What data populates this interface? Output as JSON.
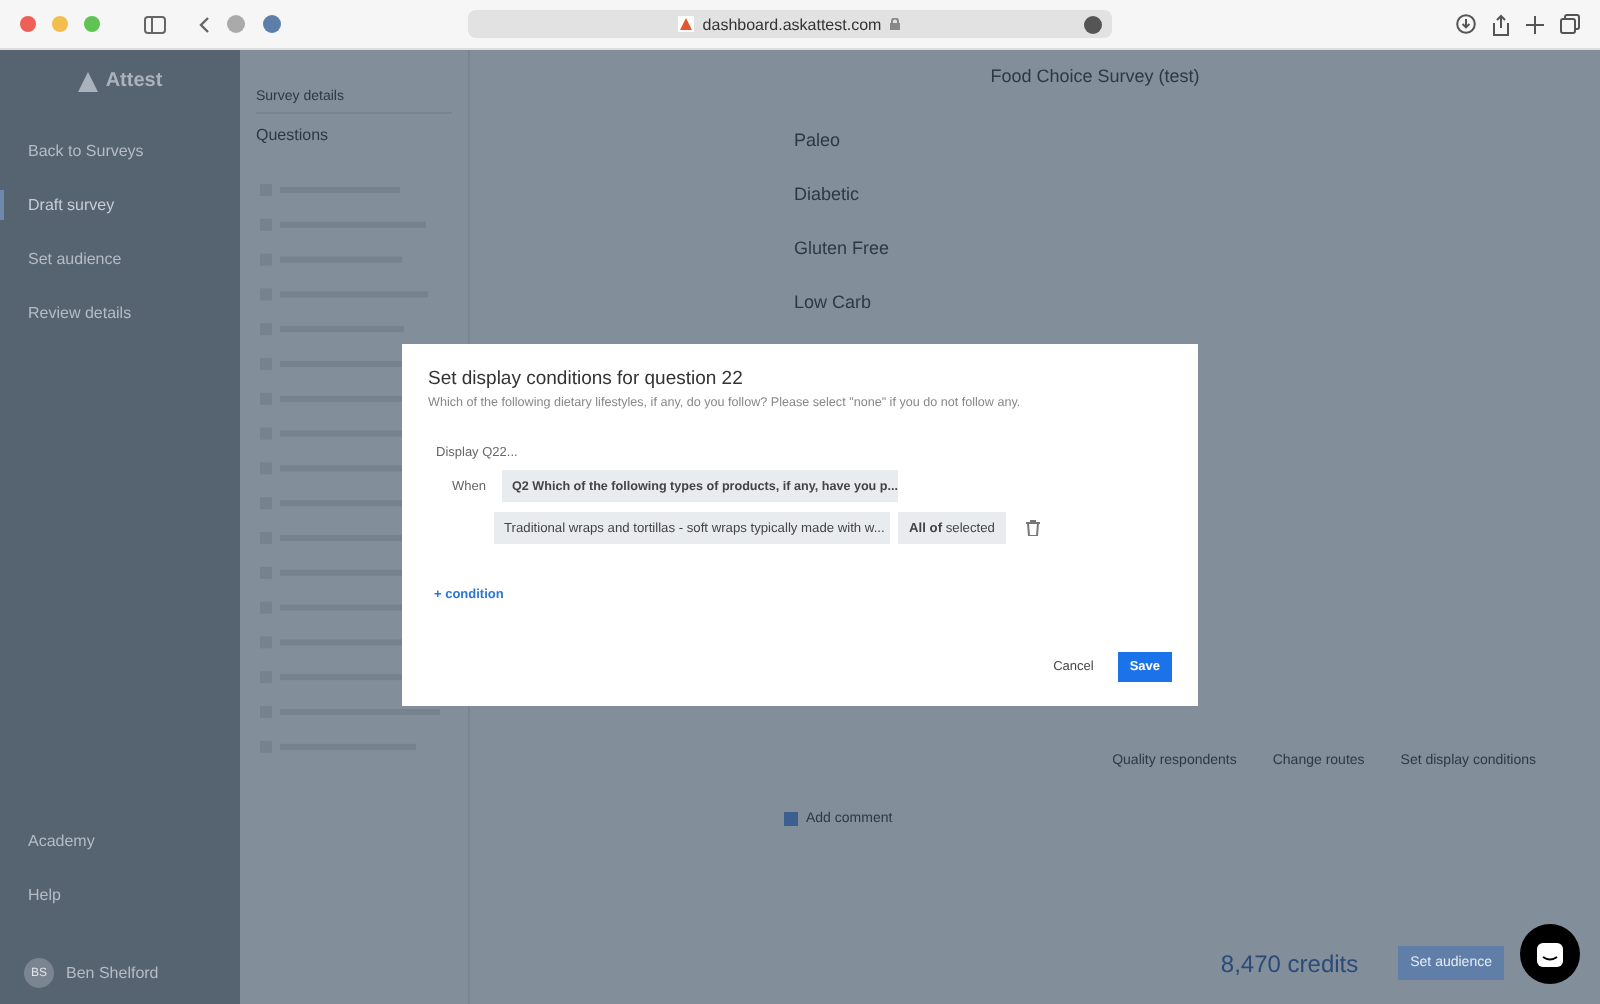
{
  "browser": {
    "url": "dashboard.askattest.com"
  },
  "sidebar": {
    "logo": "Attest",
    "items": [
      {
        "label": "Back to Surveys",
        "selected": false
      },
      {
        "label": "Draft survey",
        "selected": true
      },
      {
        "label": "Set audience",
        "selected": false
      },
      {
        "label": "Review details",
        "selected": false
      }
    ],
    "footer_items": [
      {
        "label": "Academy"
      },
      {
        "label": "Help"
      }
    ],
    "user": {
      "initials": "BS",
      "name": "Ben Shelford"
    }
  },
  "questions_panel": {
    "section": "Survey details",
    "heading": "Questions"
  },
  "main": {
    "title": "Food Choice Survey (test)",
    "answers": [
      {
        "label": "Paleo"
      },
      {
        "label": "Diabetic"
      },
      {
        "label": "Gluten Free"
      },
      {
        "label": "Low Carb"
      }
    ],
    "actions": [
      "Quality respondents",
      "Change routes",
      "Set display conditions"
    ],
    "add_comment": {
      "label": "Add comment",
      "checked": true
    },
    "credits": "8,470 credits",
    "primary_button": "Set audience"
  },
  "modal": {
    "title": "Set display conditions for question 22",
    "subtitle": "Which of the following dietary lifestyles, if any, do you follow? Please select \"none\" if you do not follow any.",
    "display_label": "Display Q22...",
    "when_label": "When",
    "question_select": "Q2 Which of the following types of products, if any, have you p...",
    "answer_select": "Traditional wraps and tortillas - soft wraps typically made with w...",
    "match_select": "**All of** selected",
    "add_condition": "+ condition",
    "cancel": "Cancel",
    "save": "Save"
  }
}
